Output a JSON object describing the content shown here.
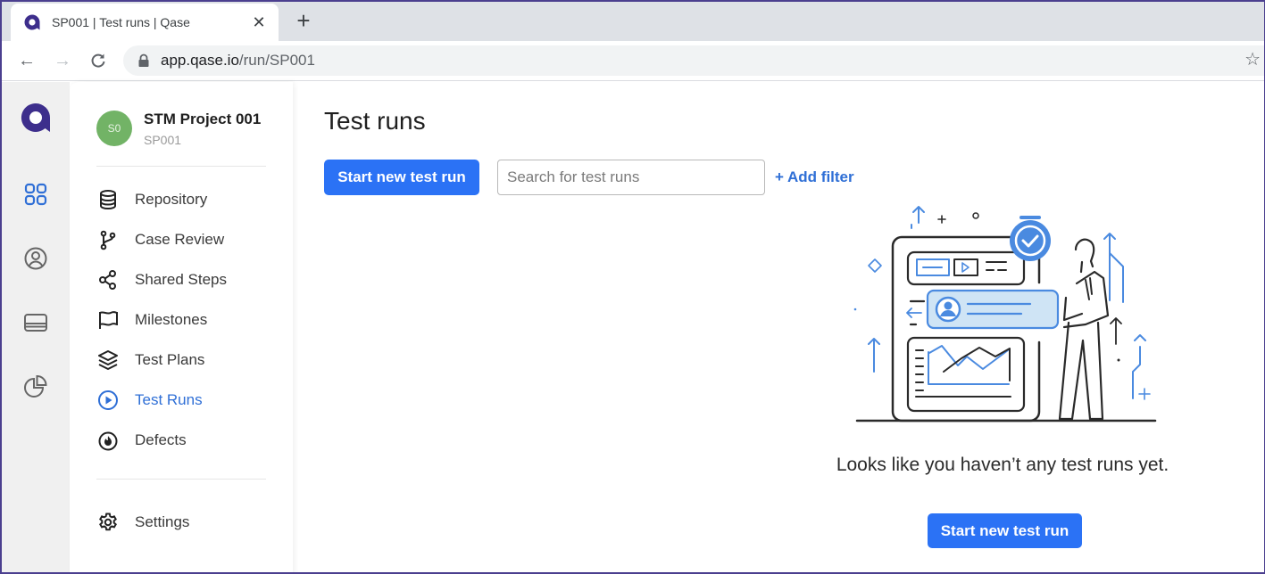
{
  "browser": {
    "tab_title": "SP001 | Test runs | Qase",
    "tab_close_icon": "close-icon",
    "new_tab_icon": "plus-icon",
    "url_host": "app.qase.io",
    "url_path": "/run/SP001",
    "back_icon": "←",
    "forward_icon": "→",
    "reload_icon": "⟳",
    "star_icon": "☆",
    "close_glyph": "✕",
    "new_tab_glyph": "+"
  },
  "rail": {
    "items": [
      "projects-icon",
      "profile-icon",
      "workspace-icon",
      "reports-icon"
    ]
  },
  "project": {
    "avatar_initials": "S0",
    "name": "STM Project 001",
    "code": "SP001",
    "avatar_color": "#72b366"
  },
  "nav": {
    "items": [
      {
        "label": "Repository",
        "icon": "database-icon"
      },
      {
        "label": "Case Review",
        "icon": "branch-icon"
      },
      {
        "label": "Shared Steps",
        "icon": "share-icon"
      },
      {
        "label": "Milestones",
        "icon": "flag-icon"
      },
      {
        "label": "Test Plans",
        "icon": "layers-icon"
      },
      {
        "label": "Test Runs",
        "icon": "play-circle-icon",
        "active": true
      },
      {
        "label": "Defects",
        "icon": "fire-icon"
      }
    ],
    "settings_label": "Settings"
  },
  "main": {
    "title": "Test runs",
    "start_button_label": "Start new test run",
    "search_placeholder": "Search for test runs",
    "search_value": "",
    "add_filter_label": "+ Add filter",
    "empty_message": "Looks like you haven’t any test runs yet.",
    "empty_button_label": "Start new test run"
  },
  "colors": {
    "accent": "#2b72f5",
    "link": "#2f6fd6",
    "brand": "#3d2e8c"
  }
}
